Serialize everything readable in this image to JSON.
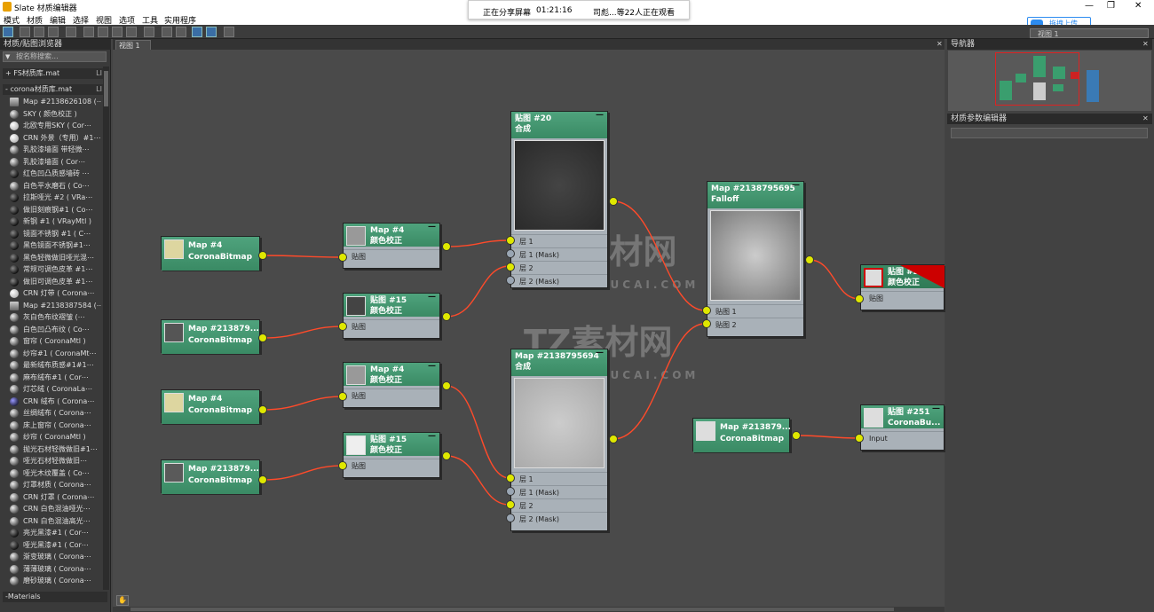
{
  "window": {
    "title": "Slate 材质编辑器",
    "controls": [
      "—",
      "❐",
      "✕"
    ]
  },
  "share_banner": {
    "status": "正在分享屏幕",
    "timer": "01:21:16",
    "viewers": "司彪...等22人正在观看"
  },
  "upload_button": "拖拽上传",
  "menu": [
    "模式",
    "材质",
    "编辑",
    "选择",
    "视图",
    "选项",
    "工具",
    "实用程序"
  ],
  "view_selector": "视图 1",
  "left_panel": {
    "title": "材质/贴图浏览器",
    "search_placeholder": "按名称搜索...",
    "libraries": [
      {
        "toggle": "+",
        "name": "FS材质库.mat",
        "tag": "LI"
      },
      {
        "toggle": "-",
        "name": "corona材质库.mat",
        "tag": "LI"
      }
    ],
    "items": [
      "Map #2138626108 (⋯",
      "SKY ( 颜色校正 )",
      "北欧专用SKY ( Cor⋯",
      "CRN 外景（专用）#1⋯",
      "乳胶漆墙面 带轻微⋯",
      "乳胶漆墙面 ( Cor⋯",
      "红色凹凸质感墙砖 ⋯",
      "白色平水磨石 ( Co⋯",
      "拉斯哑光 #2 ( VRa⋯",
      "做旧刻痕钢#1 ( Co⋯",
      "新钢 #1 ( VRayMtl )",
      "镜面不锈钢 #1 ( C⋯",
      "黑色镜面不锈钢#1⋯",
      "黑色轻微做旧哑光混⋯",
      "常规可调色皮革 #1⋯",
      "做旧可调色皮革 #1⋯",
      "CRN 灯带 ( Corona⋯",
      "Map #2138387584 (⋯",
      "灰白色布纹褶皱 (⋯",
      "白色凹凸布纹 ( Co⋯",
      "窗帘 ( CoronaMtl )",
      "纱帘#1 ( CoronaMt⋯",
      "最新绒布质感#1#1⋯",
      "麻布绒布#1 ( Cor⋯",
      "灯芯绒 ( CoronaLa⋯",
      "CRN 绒布 ( Corona⋯",
      "丝绸绒布 ( Corona⋯",
      "床上窗帘 ( Corona⋯",
      "纱帘 ( CoronaMtl )",
      "抛光石材轻微做旧#1⋯",
      "哑光石材轻微做旧⋯",
      "哑光木纹覆盖 ( Co⋯",
      "灯罩材质 ( Corona⋯",
      "CRN 灯罩 ( Corona⋯",
      "CRN 白色混油哑光⋯",
      "CRN 白色混油高光⋯",
      "亮光黑漆#1 ( Cor⋯",
      "哑光黑漆#1 ( Cor⋯",
      "渐变玻璃 ( Corona⋯",
      "薄薄玻璃 ( Corona⋯",
      "磨砂玻璃 ( Corona⋯"
    ],
    "footer": "-Materials"
  },
  "tab": "视图 1",
  "nav_title": "导航器",
  "param_title": "材质参数编辑器",
  "watermark": {
    "brand": "TZ素材网",
    "url": "TZSUCAI.COM"
  },
  "nodes": {
    "n1": {
      "title": "Map #4",
      "sub": "CoronaBitmap"
    },
    "n2": {
      "title": "Map #213879...",
      "sub": "CoronaBitmap"
    },
    "n3": {
      "title": "Map #4",
      "sub": "CoronaBitmap"
    },
    "n4": {
      "title": "Map #213879...",
      "sub": "CoronaBitmap"
    },
    "cc1": {
      "title": "Map #4",
      "sub": "颜色校正",
      "slot": "贴图"
    },
    "cc2": {
      "title": "贴图 #15",
      "sub": "颜色校正",
      "slot": "贴图"
    },
    "cc3": {
      "title": "Map #4",
      "sub": "颜色校正",
      "slot": "贴图"
    },
    "cc4": {
      "title": "贴图 #15",
      "sub": "颜色校正",
      "slot": "贴图"
    },
    "comp1": {
      "title": "贴图 #20",
      "sub": "合成",
      "slots": [
        "层 1",
        "层 1 (Mask)",
        "层 2",
        "层 2 (Mask)"
      ]
    },
    "comp2": {
      "title": "Map #2138795694",
      "sub": "合成",
      "slots": [
        "层 1",
        "层 1 (Mask)",
        "层 2",
        "层 2 (Mask)"
      ]
    },
    "falloff": {
      "title": "Map #2138795695",
      "sub": "Falloff",
      "slots": [
        "贴图 1",
        "贴图 2"
      ]
    },
    "cc224": {
      "title": "贴图 #224",
      "sub": "颜色校正",
      "slot": "贴图"
    },
    "bmp5": {
      "title": "Map #213879...",
      "sub": "CoronaBitmap"
    },
    "bmp251": {
      "title": "贴图 #251",
      "sub": "CoronaBu...",
      "slot": "Input"
    }
  },
  "colors": {
    "node_header": "#3a8a64",
    "wire": "#ff4a2a",
    "socket": "#dfe800"
  }
}
